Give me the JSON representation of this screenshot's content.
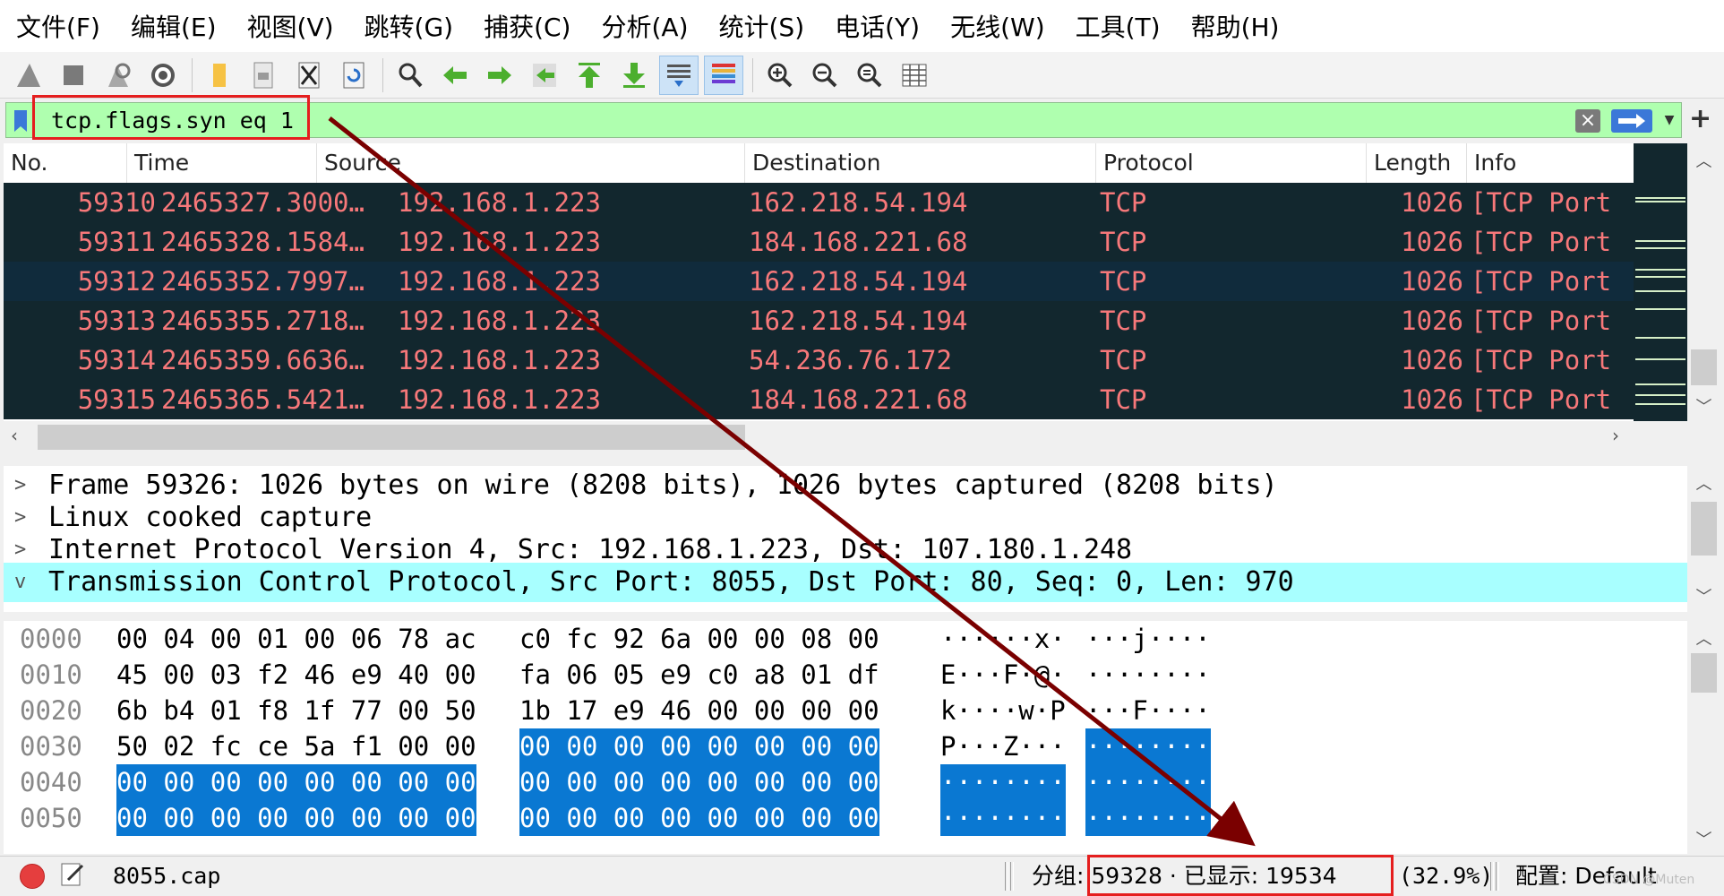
{
  "menu": [
    "文件(F)",
    "编辑(E)",
    "视图(V)",
    "跳转(G)",
    "捕获(C)",
    "分析(A)",
    "统计(S)",
    "电话(Y)",
    "无线(W)",
    "工具(T)",
    "帮助(H)"
  ],
  "filter": {
    "value": "tcp.flags.syn eq 1",
    "highlight_color": "#e51e1e",
    "background": "#afffaf"
  },
  "packet_list": {
    "columns": [
      "No.",
      "Time",
      "Source",
      "Destination",
      "Protocol",
      "Length",
      "Info"
    ],
    "rows": [
      {
        "no": "59310",
        "time": "2465327.3000…",
        "src": "192.168.1.223",
        "dst": "162.218.54.194",
        "proto": "TCP",
        "len": "1026",
        "info": "[TCP Port"
      },
      {
        "no": "59311",
        "time": "2465328.1584…",
        "src": "192.168.1.223",
        "dst": "184.168.221.68",
        "proto": "TCP",
        "len": "1026",
        "info": "[TCP Port"
      },
      {
        "no": "59312",
        "time": "2465352.7997…",
        "src": "192.168.1.223",
        "dst": "162.218.54.194",
        "proto": "TCP",
        "len": "1026",
        "info": "[TCP Port"
      },
      {
        "no": "59313",
        "time": "2465355.2718…",
        "src": "192.168.1.223",
        "dst": "162.218.54.194",
        "proto": "TCP",
        "len": "1026",
        "info": "[TCP Port"
      },
      {
        "no": "59314",
        "time": "2465359.6636…",
        "src": "192.168.1.223",
        "dst": "54.236.76.172",
        "proto": "TCP",
        "len": "1026",
        "info": "[TCP Port"
      },
      {
        "no": "59315",
        "time": "2465365.5421…",
        "src": "192.168.1.223",
        "dst": "184.168.221.68",
        "proto": "TCP",
        "len": "1026",
        "info": "[TCP Port"
      }
    ],
    "row_fg": "#f7787a",
    "row_bg": "#12272e"
  },
  "details": [
    {
      "expander": ">",
      "text": "Frame 59326: 1026 bytes on wire (8208 bits), 1026 bytes captured (8208 bits)"
    },
    {
      "expander": ">",
      "text": "Linux cooked capture"
    },
    {
      "expander": ">",
      "text": "Internet Protocol Version 4, Src: 192.168.1.223, Dst: 107.180.1.248"
    },
    {
      "expander": "v",
      "text": "Transmission Control Protocol, Src Port: 8055, Dst Port: 80, Seq: 0, Len: 970"
    }
  ],
  "bytes": [
    {
      "offset": "0000",
      "hex1": "00 04 00 01 00 06 78 ac",
      "hex2": "c0 fc 92 6a 00 00 08 00",
      "ascii1": "······x·",
      "ascii2": "···j····"
    },
    {
      "offset": "0010",
      "hex1": "45 00 03 f2 46 e9 40 00",
      "hex2": "fa 06 05 e9 c0 a8 01 df",
      "ascii1": "E···F·@·",
      "ascii2": "········"
    },
    {
      "offset": "0020",
      "hex1": "6b b4 01 f8 1f 77 00 50",
      "hex2": "1b 17 e9 46 00 00 00 00",
      "ascii1": "k····w·P",
      "ascii2": "···F····"
    },
    {
      "offset": "0030",
      "hex1": "50 02 fc ce 5a f1 00 00",
      "hex2": "00 00 00 00 00 00 00 00",
      "ascii1": "P···Z···",
      "ascii2": "········"
    },
    {
      "offset": "0040",
      "hex1": "00 00 00 00 00 00 00 00",
      "hex2": "00 00 00 00 00 00 00 00",
      "ascii1": "········",
      "ascii2": "········"
    },
    {
      "offset": "0050",
      "hex1": "00 00 00 00 00 00 00 00",
      "hex2": "00 00 00 00 00 00 00 00",
      "ascii1": "········",
      "ascii2": "········"
    }
  ],
  "status": {
    "file": "8055.cap",
    "packets_label": "分组: 59328 · 已显示: 19534",
    "percent": "(32.9%)",
    "profile": "配置: Default",
    "watermark": "CSDN @Muten"
  },
  "toolbar_icons": [
    "shark-fin-start-icon",
    "stop-icon",
    "restart-icon",
    "capture-options-icon",
    "open-folder-icon",
    "save-file-icon",
    "close-file-icon",
    "reload-icon",
    "find-icon",
    "go-back-icon",
    "go-forward-icon",
    "go-to-packet-icon",
    "go-first-icon",
    "go-last-icon",
    "autoscroll-icon",
    "colorize-icon",
    "zoom-in-icon",
    "zoom-out-icon",
    "zoom-normal-icon",
    "resize-columns-icon"
  ]
}
